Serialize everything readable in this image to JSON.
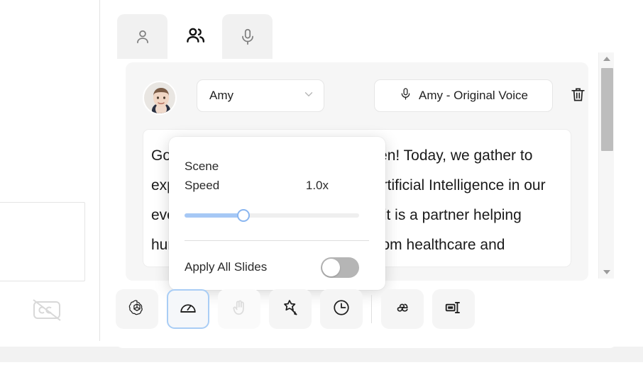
{
  "tabs": [
    {
      "id": "single-speaker",
      "icon": "person-icon",
      "active": false
    },
    {
      "id": "multi-speaker",
      "icon": "people-icon",
      "active": true
    },
    {
      "id": "voice",
      "icon": "microphone-icon",
      "active": true
    }
  ],
  "speaker": {
    "avatar_alt": "Amy",
    "name": "Amy",
    "voice_label": "Amy - Original Voice",
    "voice_icon": "microphone-icon",
    "dropdown_icon": "chevron-down-icon",
    "delete_icon": "trash-icon",
    "script": "Good morning, ladies and gentlemen! Today, we gather to explore the transformative role of Artificial Intelligence in our everyday lives. AI is not just a tool, it is a partner helping humanity tackle great challenges from healthcare and education to creative"
  },
  "popover": {
    "title": "Scene",
    "speed_label": "Speed",
    "speed_value": "1.0x",
    "speed_percent": 34,
    "apply_all_label": "Apply All Slides",
    "apply_all_on": false,
    "accent_color": "#a6c8f5"
  },
  "toolbar": {
    "items": [
      {
        "id": "ai-assistant",
        "icon": "openai-logo-icon",
        "state": "normal"
      },
      {
        "id": "speed",
        "icon": "speedometer-icon",
        "state": "active"
      },
      {
        "id": "gesture",
        "icon": "hand-wave-icon",
        "state": "disabled"
      },
      {
        "id": "effects",
        "icon": "magic-wand-star-icon",
        "state": "normal"
      },
      {
        "id": "pause",
        "icon": "clock-icon",
        "state": "normal"
      },
      {
        "id": "pronunciation",
        "icon": "ae-ligature-icon",
        "state": "normal"
      },
      {
        "id": "text-break",
        "icon": "text-break-icon",
        "state": "normal"
      }
    ]
  },
  "canvas": {
    "captions_icon": "captions-off-icon"
  },
  "scrollbar": {
    "up_icon": "caret-up-icon",
    "down_icon": "caret-down-icon"
  }
}
